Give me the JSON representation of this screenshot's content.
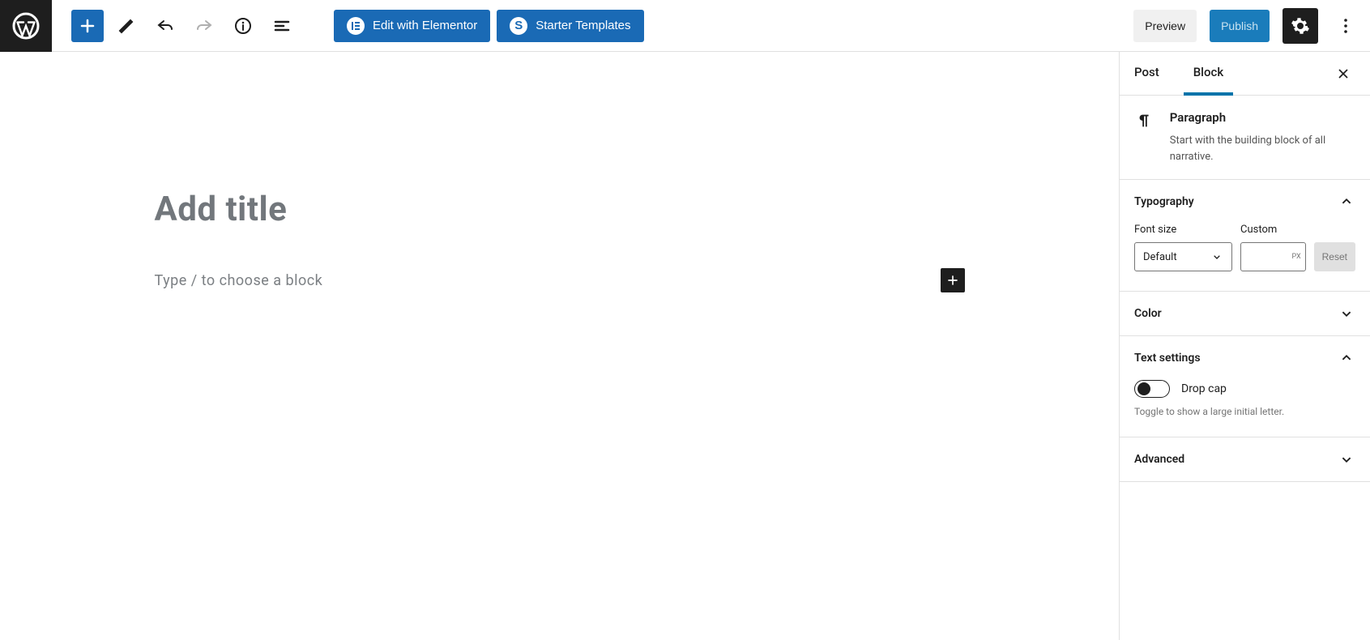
{
  "toolbar": {
    "elementor_label": "Edit with Elementor",
    "starter_label": "Starter Templates",
    "preview_label": "Preview",
    "publish_label": "Publish"
  },
  "editor": {
    "title_placeholder": "Add title",
    "block_placeholder": "Type / to choose a block"
  },
  "sidebar": {
    "tabs": {
      "post": "Post",
      "block": "Block"
    },
    "block_info": {
      "name": "Paragraph",
      "desc": "Start with the building block of all narrative."
    },
    "typography": {
      "title": "Typography",
      "font_size_label": "Font size",
      "custom_label": "Custom",
      "select_value": "Default",
      "unit": "PX",
      "reset": "Reset"
    },
    "color": {
      "title": "Color"
    },
    "text_settings": {
      "title": "Text settings",
      "toggle_label": "Drop cap",
      "toggle_desc": "Toggle to show a large initial letter."
    },
    "advanced": {
      "title": "Advanced"
    }
  }
}
